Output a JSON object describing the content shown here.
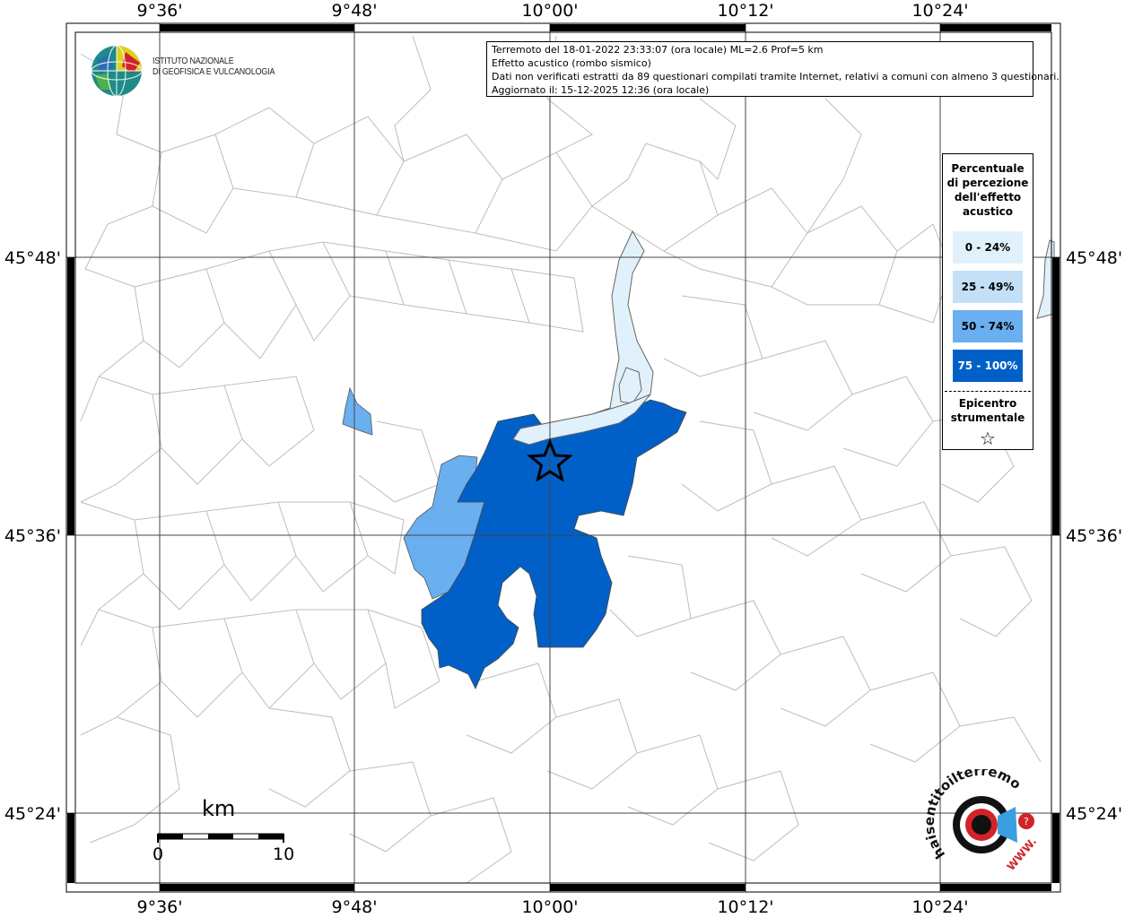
{
  "info": {
    "line1": "Terremoto del 18-01-2022 23:33:07 (ora locale) ML=2.6 Prof=5 km",
    "line2": "Effetto acustico (rombo sismico)",
    "line3": "Dati non verificati estratti da 89 questionari compilati tramite Internet, relativi a comuni con almeno 3 questionari.",
    "line4": "Aggiornato il: 15-12-2025 12:36 (ora locale)"
  },
  "legend": {
    "title": "Percentuale\ndi percezione\ndell'effetto\nacustico",
    "classes": [
      {
        "label": "0 - 24%",
        "color": "#e0f1fb",
        "text_color": "#000000"
      },
      {
        "label": "25 - 49%",
        "color": "#c3e0f6",
        "text_color": "#000000"
      },
      {
        "label": "50 - 74%",
        "color": "#6aaff0",
        "text_color": "#000000"
      },
      {
        "label": "75 - 100%",
        "color": "#0160c8",
        "text_color": "#ffffff"
      }
    ],
    "epicenter_label": "Epicentro\nstrumentale",
    "epicenter_symbol": "☆"
  },
  "axes": {
    "top": [
      "9°36'",
      "9°48'",
      "10°00'",
      "10°12'",
      "10°24'"
    ],
    "bottom": [
      "9°36'",
      "9°48'",
      "10°00'",
      "10°12'",
      "10°24'"
    ],
    "left": [
      "45°48'",
      "45°36'",
      "45°24'"
    ],
    "right": [
      "45°48'",
      "45°36'",
      "45°24'"
    ]
  },
  "logo": {
    "ingv_text": "ISTITUTO NAZIONALE\nDI GEOFISICA E VULCANOLOGIA",
    "hsi_text": "haisentitoilterremoto.it",
    "hsi_url": "WWW."
  },
  "scale": {
    "unit": "km",
    "start": "0",
    "end": "10"
  },
  "colors": {
    "class0": "#e0f1fb",
    "class2": "#6aaff0",
    "class3": "#0160c8"
  }
}
